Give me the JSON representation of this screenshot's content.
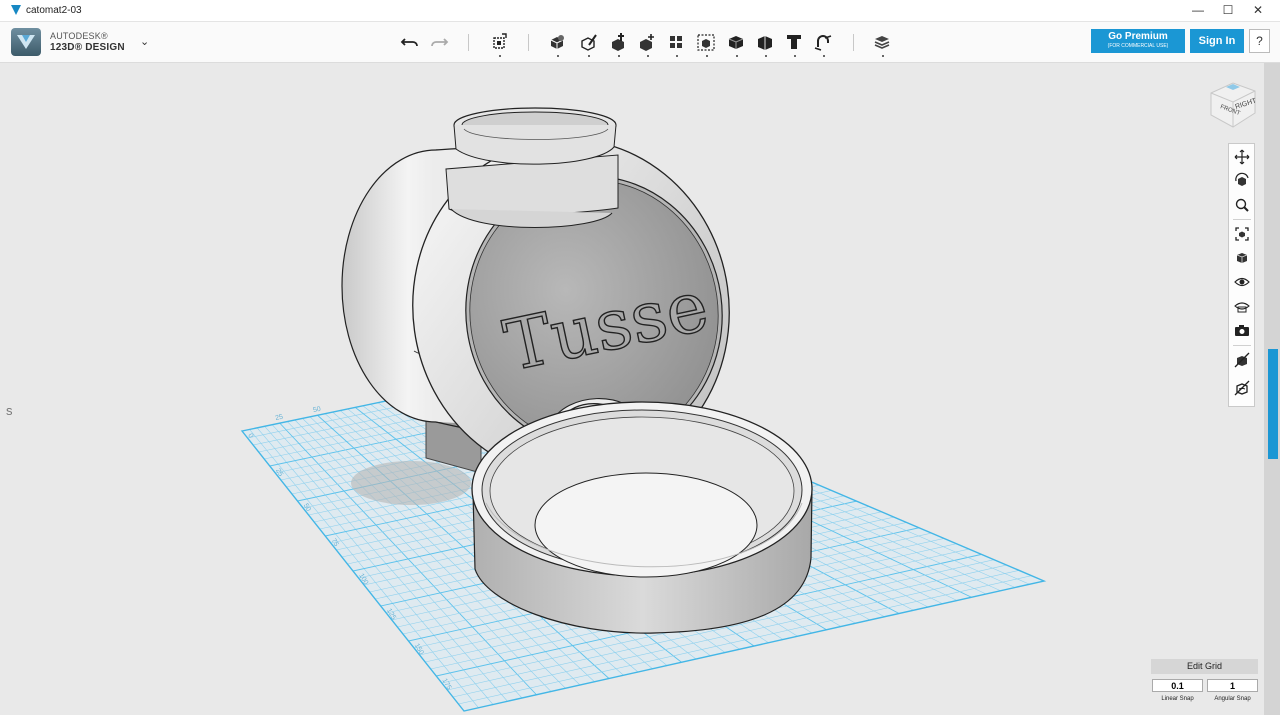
{
  "window": {
    "title": "catomat2-03",
    "controls": {
      "minimize": "—",
      "maximize": "☐",
      "close": "✕"
    }
  },
  "app": {
    "brand_top": "AUTODESK®",
    "brand_bottom": "123D® DESIGN",
    "menu_caret": "⌄"
  },
  "toolbar": {
    "tools": [
      {
        "name": "undo-icon"
      },
      {
        "name": "redo-icon"
      },
      {
        "name": "transform-icon"
      },
      {
        "name": "primitives-icon"
      },
      {
        "name": "sketch-icon"
      },
      {
        "name": "construct-icon"
      },
      {
        "name": "modify-icon"
      },
      {
        "name": "pattern-icon"
      },
      {
        "name": "grouping-icon"
      },
      {
        "name": "combine-icon"
      },
      {
        "name": "measure-icon"
      },
      {
        "name": "text-icon"
      },
      {
        "name": "snap-icon"
      },
      {
        "name": "material-icon"
      }
    ]
  },
  "account": {
    "premium_label": "Go Premium",
    "premium_sub": "(FOR COMMERCIAL USE)",
    "signin_label": "Sign In",
    "help_label": "?"
  },
  "viewcube": {
    "face_front": "FRONT",
    "face_right": "RIGHT"
  },
  "navbar": {
    "items": [
      {
        "name": "pan-icon"
      },
      {
        "name": "orbit-icon"
      },
      {
        "name": "zoom-icon"
      },
      {
        "name": "fit-icon"
      },
      {
        "name": "view-icon"
      },
      {
        "name": "visibility-icon"
      },
      {
        "name": "hidden-icon"
      },
      {
        "name": "camera-icon"
      },
      {
        "name": "material-toggle-icon"
      },
      {
        "name": "outline-toggle-icon"
      }
    ]
  },
  "model": {
    "embossed_text": "Tusse"
  },
  "grid": {
    "labels": [
      "0",
      "25",
      "50",
      "75",
      "100",
      "125",
      "150",
      "175",
      "200"
    ],
    "far_labels": [
      "25",
      "50"
    ]
  },
  "left_fragment": "s",
  "edit_grid": {
    "header": "Edit Grid",
    "linear_value": "0.1",
    "angular_value": "1",
    "linear_label": "Linear Snap",
    "angular_label": "Angular Snap"
  }
}
